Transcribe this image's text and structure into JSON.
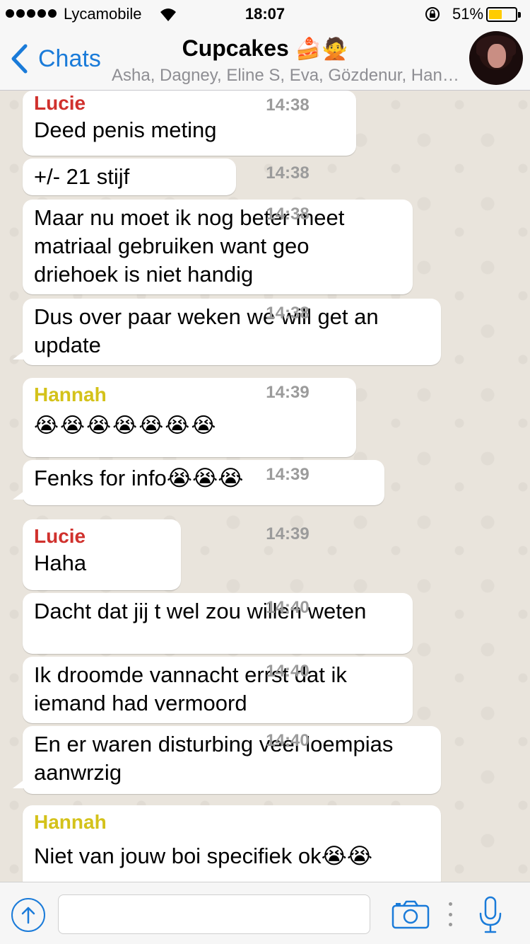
{
  "status": {
    "carrier": "Lycamobile",
    "time": "18:07",
    "battery_percent": "51%",
    "battery_level": 0.51
  },
  "nav": {
    "back_label": "Chats",
    "title": "Cupcakes",
    "title_emoji": "🍰🙅",
    "subtitle": "Asha, Dagney, Eline S, Eva, Gözdenur, Han…"
  },
  "messages": [
    {
      "sender": "Lucie",
      "text": "Deed penis meting",
      "time": "14:38"
    },
    {
      "sender": "",
      "text": "+/- 21 stijf",
      "time": "14:38"
    },
    {
      "sender": "",
      "text": "Maar nu moet ik nog beter meet matriaal gebruiken want geo driehoek is niet handig",
      "time": "14:38"
    },
    {
      "sender": "",
      "text": "Dus over paar weken we will get an update",
      "time": "14:38"
    },
    {
      "sender": "Hannah",
      "text": "😭😭😭😭😭😭😭",
      "time": "14:39"
    },
    {
      "sender": "",
      "text": "Fenks for info😭😭😭",
      "time": "14:39"
    },
    {
      "sender": "Lucie",
      "text": "Haha",
      "time": "14:39"
    },
    {
      "sender": "",
      "text": "Dacht dat jij t wel zou willen weten",
      "time": "14:40"
    },
    {
      "sender": "",
      "text": "Ik droomde vannacht errst dat ik iemand had vermoord",
      "time": "14:40"
    },
    {
      "sender": "",
      "text": "En er waren disturbing veel loempias aanwrzig",
      "time": "14:40"
    },
    {
      "sender": "Hannah",
      "text": "Niet van jouw boi specifiek ok😭😭",
      "time": ""
    }
  ],
  "colors": {
    "accent": "#1a7bd9",
    "lucie": "#d0312d",
    "hannah": "#d4c21a"
  },
  "icons": {
    "back": "chevron-left-icon",
    "attach": "upload-arrow-icon",
    "camera": "camera-icon",
    "mic": "microphone-icon"
  }
}
